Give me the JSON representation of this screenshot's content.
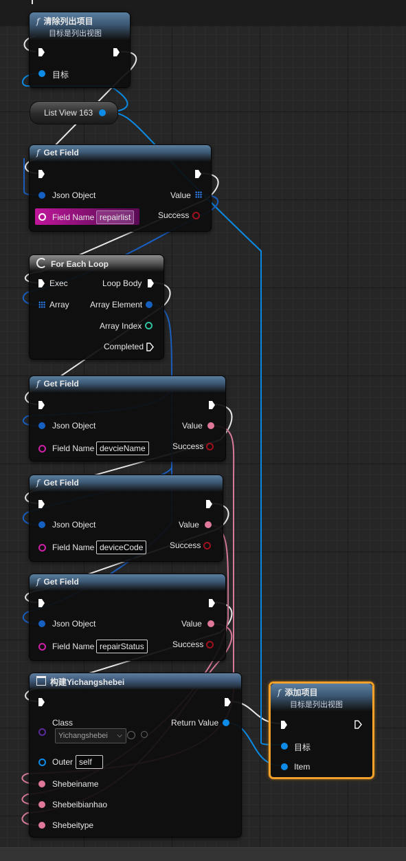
{
  "nodes": {
    "clear_items": {
      "title": "清除列出项目",
      "subtitle": "目标是列出视图",
      "target_label": "目标"
    },
    "list_view": {
      "label": "List View 163"
    },
    "get_field_1": {
      "title": "Get Field",
      "json_object": "Json Object",
      "field_name_label": "Field Name",
      "field_value": "repairlist",
      "value": "Value",
      "success": "Success"
    },
    "for_each_loop": {
      "title": "For Each Loop",
      "exec": "Exec",
      "loop_body": "Loop Body",
      "array": "Array",
      "array_element": "Array Element",
      "array_index": "Array Index",
      "completed": "Completed"
    },
    "get_field_2": {
      "title": "Get Field",
      "json_object": "Json Object",
      "field_name_label": "Field Name",
      "field_value": "devcieName",
      "value": "Value",
      "success": "Success"
    },
    "get_field_3": {
      "title": "Get Field",
      "json_object": "Json Object",
      "field_name_label": "Field Name",
      "field_value": "deviceCode",
      "value": "Value",
      "success": "Success"
    },
    "get_field_4": {
      "title": "Get Field",
      "json_object": "Json Object",
      "field_name_label": "Field Name",
      "field_value": "repairStatus",
      "value": "Value",
      "success": "Success"
    },
    "construct": {
      "title": "构建Yichangshebei",
      "class_label": "Class",
      "class_value": "Yichangshebei",
      "return_value": "Return Value",
      "outer_label": "Outer",
      "outer_value": "self",
      "pin1": "Shebeiname",
      "pin2": "Shebeibianhao",
      "pin3": "Shebeitype"
    },
    "add_item": {
      "title": "添加项目",
      "subtitle": "目标是列出视图",
      "target_label": "目标",
      "item_label": "Item"
    }
  },
  "colors": {
    "exec": "#ffffff",
    "object": "#0c8ce8",
    "json": "#1560c0",
    "string": "#e0789a",
    "bool": "#8e0a14",
    "int": "#2ec4a0",
    "selection": "#f2a12b",
    "field_name": "#c0169a"
  },
  "icons": {
    "function": "function-icon",
    "loop": "loop-icon",
    "construct": "construct-icon"
  }
}
